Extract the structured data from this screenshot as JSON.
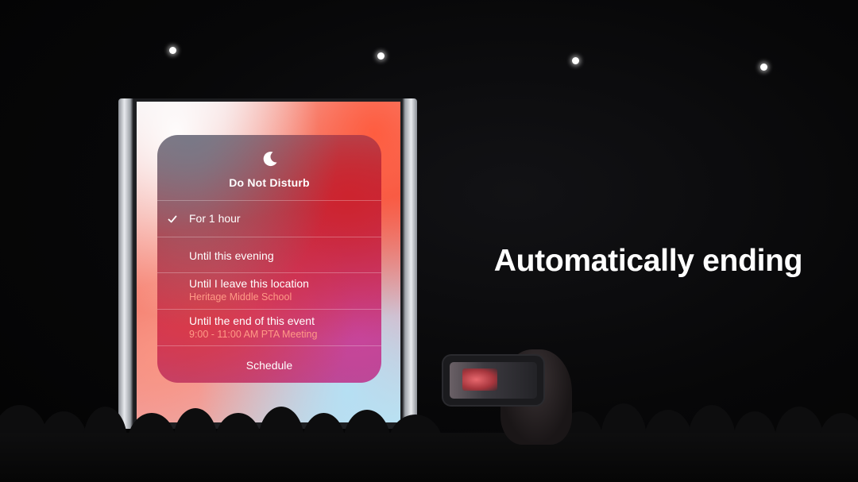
{
  "dnd": {
    "title": "Do Not Disturb",
    "options": [
      {
        "label": "For 1 hour",
        "subtitle": "",
        "checked": true
      },
      {
        "label": "Until this evening",
        "subtitle": "",
        "checked": false
      },
      {
        "label": "Until I leave this location",
        "subtitle": "Heritage Middle School",
        "checked": false
      },
      {
        "label": "Until the end of this event",
        "subtitle": "9:00 - 11:00 AM PTA Meeting",
        "checked": false
      }
    ],
    "schedule_label": "Schedule"
  },
  "slide": {
    "headline": "Automatically ending"
  },
  "colors": {
    "background": "#050506",
    "subtitle_accent": "#ff9a86",
    "headline_text": "#ffffff"
  },
  "icons": {
    "dnd_icon": "moon-icon",
    "selected_icon": "checkmark-icon"
  }
}
